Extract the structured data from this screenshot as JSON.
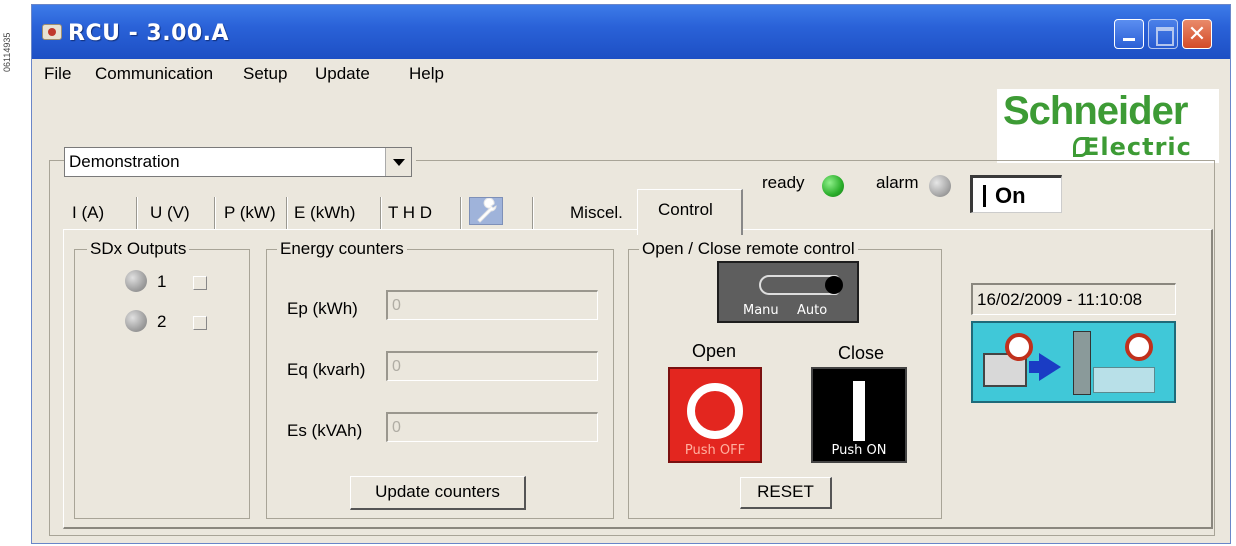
{
  "side_id": "06114935",
  "window": {
    "title": "RCU - 3.00.A"
  },
  "menu": {
    "items": [
      {
        "label": "File"
      },
      {
        "label": "Communication"
      },
      {
        "label": "Setup"
      },
      {
        "label": "Update"
      },
      {
        "label": "Help"
      }
    ]
  },
  "logo": {
    "top": "Schneider",
    "bottom": "Electric"
  },
  "device_select": {
    "value": "Demonstration"
  },
  "status": {
    "ready_label": "ready",
    "alarm_label": "alarm",
    "ready_color": "#2aae2a",
    "alarm_color": "#a8a8a8",
    "power_label": "On"
  },
  "tabs": [
    {
      "label": "I (A)"
    },
    {
      "label": "U (V)"
    },
    {
      "label": "P (kW)"
    },
    {
      "label": "E (kWh)"
    },
    {
      "label": "T H D"
    },
    {
      "label": "wrench-icon"
    },
    {
      "label": "Miscel."
    },
    {
      "label": "Control"
    }
  ],
  "sdx": {
    "title": "SDx Outputs",
    "outputs": [
      {
        "num": "1"
      },
      {
        "num": "2"
      }
    ]
  },
  "energy": {
    "title": "Energy counters",
    "rows": [
      {
        "label": "Ep (kWh)",
        "value": "0"
      },
      {
        "label": "Eq (kvarh)",
        "value": "0"
      },
      {
        "label": "Es (kVAh)",
        "value": "0"
      }
    ],
    "update_button": "Update counters"
  },
  "remote": {
    "title": "Open / Close remote control",
    "manu_label": "Manu",
    "auto_label": "Auto",
    "open_label": "Open",
    "close_label": "Close",
    "push_off_label": "Push OFF",
    "push_on_label": "Push ON",
    "reset_button": "RESET"
  },
  "clock": {
    "datetime": "16/02/2009 - 11:10:08"
  }
}
